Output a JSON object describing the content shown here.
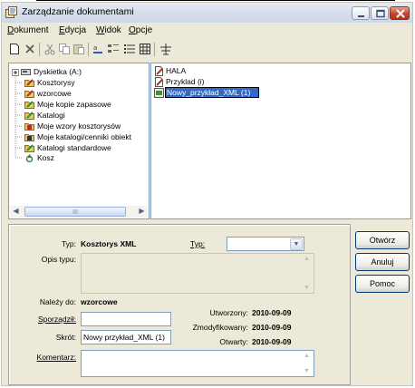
{
  "window": {
    "title": "Zarządzanie dokumentami"
  },
  "menu": [
    {
      "label": "Dokument",
      "u": "D",
      "rest": "okument"
    },
    {
      "label": "Edycja",
      "u": "E",
      "rest": "dycja"
    },
    {
      "label": "Widok",
      "u": "W",
      "rest": "idok"
    },
    {
      "label": "Opcje",
      "u": "O",
      "rest": "pcje"
    }
  ],
  "tree": {
    "items": [
      {
        "label": "Dyskietka (A:)",
        "icon": "floppy-icon"
      },
      {
        "label": "Kosztorysy",
        "icon": "folder-pencil-icon"
      },
      {
        "label": "wzorcowe",
        "icon": "folder-pencil-icon"
      },
      {
        "label": "Moje kopie zapasowe",
        "icon": "folder-pencil-icon"
      },
      {
        "label": "Katalogi",
        "icon": "folder-pencil-icon"
      },
      {
        "label": "Moje wzory kosztorysów",
        "icon": "folder-book-icon"
      },
      {
        "label": "Moje katalogi/cenniki obiekt",
        "icon": "folder-book-dark-icon"
      },
      {
        "label": "Katalogi standardowe",
        "icon": "folder-pencil-icon"
      },
      {
        "label": "Kosz",
        "icon": "recycle-icon"
      }
    ],
    "scroll_grip": "III"
  },
  "files": {
    "items": [
      {
        "label": "HALA",
        "icon": "kosztorys-icon"
      },
      {
        "label": "Przyklad (i)",
        "icon": "kosztorys-icon"
      },
      {
        "label": "Nowy_przykład_XML (1)",
        "icon": "xml-doc-icon",
        "editing": true
      }
    ]
  },
  "details": {
    "type_label": "Typ:",
    "type_value": "Kosztorys XML",
    "type_combo_label": "Typ:",
    "type_combo_value": "",
    "description_label": "Opis typu:",
    "description_value": "",
    "belongs_label": "Należy do:",
    "belongs_value": "wzorcowe",
    "prepared_label": "Sporządził:",
    "prepared_value": "",
    "short_label": "Skrót:",
    "short_value": "Nowy przykład_XML (1)",
    "comment_label": "Komentarz:",
    "comment_value": "",
    "created_label": "Utworzony:",
    "created_value": "2010-09-09",
    "modified_label": "Zmodyfikowany:",
    "modified_value": "2010-09-09",
    "opened_label": "Otwarty:",
    "opened_value": "2010-09-09"
  },
  "buttons": {
    "open": "Otwórz",
    "cancel": "Anuluj",
    "help": "Pomoc"
  },
  "colors": {
    "selection": "#316ac5",
    "window_face": "#ece9d8",
    "close_button": "#c8442a"
  }
}
